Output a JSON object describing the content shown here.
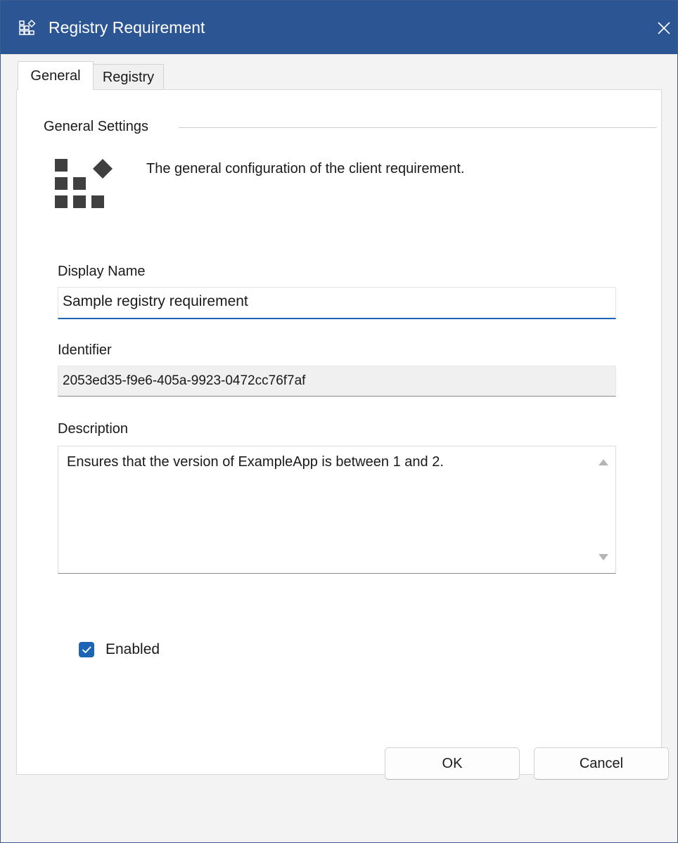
{
  "window": {
    "title": "Registry Requirement",
    "title_icon": "registry-requirement-icon",
    "close_icon": "close-icon"
  },
  "tabs": [
    {
      "label": "General",
      "selected": true
    },
    {
      "label": "Registry",
      "selected": false
    }
  ],
  "general": {
    "group_title": "General Settings",
    "icon": "requirement-blocks-icon",
    "intro": "The general configuration of the client requirement.",
    "display_name": {
      "label": "Display Name",
      "value": "Sample registry requirement"
    },
    "identifier": {
      "label": "Identifier",
      "value": "2053ed35-f9e6-405a-9923-0472cc76f7af"
    },
    "description": {
      "label": "Description",
      "value": "Ensures that the version of ExampleApp is between 1 and 2."
    },
    "enabled": {
      "label": "Enabled",
      "checked": true
    }
  },
  "buttons": {
    "ok": "OK",
    "cancel": "Cancel"
  },
  "colors": {
    "titlebar": "#2c5593",
    "accent": "#1c64b6",
    "dialog_bg": "#f3f3f3"
  }
}
